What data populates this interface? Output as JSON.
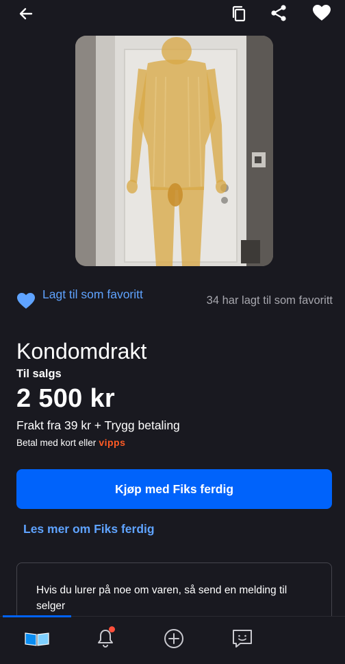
{
  "topbar": {
    "icons": [
      "back-arrow-icon",
      "copy-icon",
      "share-icon",
      "heart-filled-icon"
    ]
  },
  "listing": {
    "image_alt": "",
    "favorite_label": "Lagt til som favoritt",
    "favorite_count_text": "34 har lagt til som favoritt",
    "title": "Kondomdrakt",
    "status": "Til salgs",
    "price": "2 500 kr",
    "shipping": "Frakt fra 39 kr + Trygg betaling",
    "payment_text": "Betal med kort eller",
    "payment_brand": "vipps"
  },
  "actions": {
    "buy_label": "Kjøp med Fiks ferdig",
    "read_more_label": "Les mer om Fiks ferdig"
  },
  "message": {
    "text": "Hvis du lurer på noe om varen, så send en melding til selger"
  },
  "bottom_nav": {
    "items": [
      "home-icon",
      "notifications-icon",
      "new-ad-icon",
      "messages-icon"
    ]
  },
  "colors": {
    "background": "#191920",
    "accent": "#0063fb",
    "link": "#5fa3ff",
    "muted": "#a6a6ad",
    "vipps": "#ff5b24",
    "badge": "#ff4f3b"
  }
}
